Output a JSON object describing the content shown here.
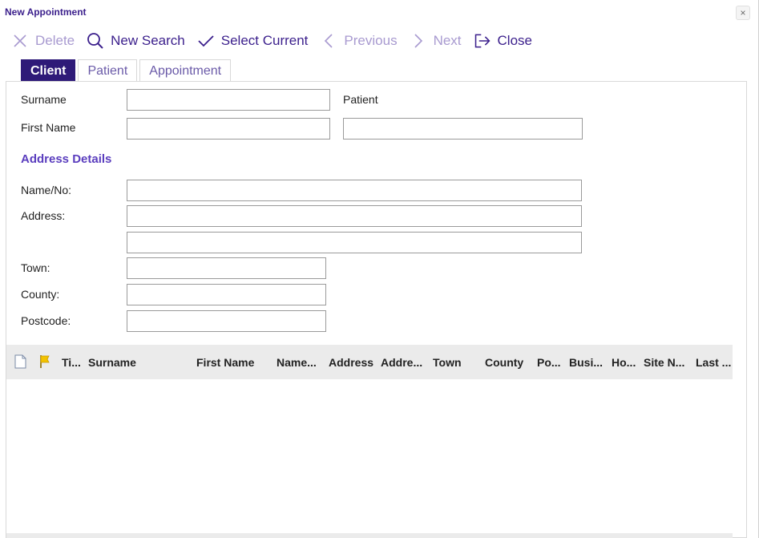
{
  "window": {
    "title": "New Appointment",
    "close_glyph": "×"
  },
  "toolbar": {
    "delete": "Delete",
    "new_search": "New Search",
    "select_current": "Select Current",
    "previous": "Previous",
    "next": "Next",
    "close": "Close"
  },
  "tabs": [
    "Client",
    "Patient",
    "Appointment"
  ],
  "active_tab": "Client",
  "form": {
    "surname_label": "Surname",
    "surname_value": "",
    "patient_label": "Patient",
    "first_name_label": "First Name",
    "first_name_value": "",
    "patient_value": "",
    "address_section": "Address Details",
    "name_no_label": "Name/No:",
    "name_no_value": "",
    "address_label": "Address:",
    "address_line1": "",
    "address_line2": "",
    "town_label": "Town:",
    "town_value": "",
    "county_label": "County:",
    "county_value": "",
    "postcode_label": "Postcode:",
    "postcode_value": ""
  },
  "grid": {
    "columns": [
      "Ti...",
      "Surname",
      "First Name",
      "Name...",
      "Address",
      "Addre...",
      "Town",
      "County",
      "Po...",
      "Busi...",
      "Ho...",
      "Site N...",
      "Last ..."
    ],
    "rows": []
  },
  "icons": {
    "delete": "close-x-icon",
    "new_search": "search-icon",
    "select_current": "check-icon",
    "previous": "chevron-left-icon",
    "next": "chevron-right-icon",
    "close": "exit-icon",
    "grid_doc": "document-icon",
    "grid_flag": "flag-icon"
  },
  "colors": {
    "brand": "#3b1f8c",
    "active_tab": "#2e1a78",
    "disabled": "#a89ad0",
    "section_heading": "#5a3dbe",
    "flag": "#f2c200"
  }
}
